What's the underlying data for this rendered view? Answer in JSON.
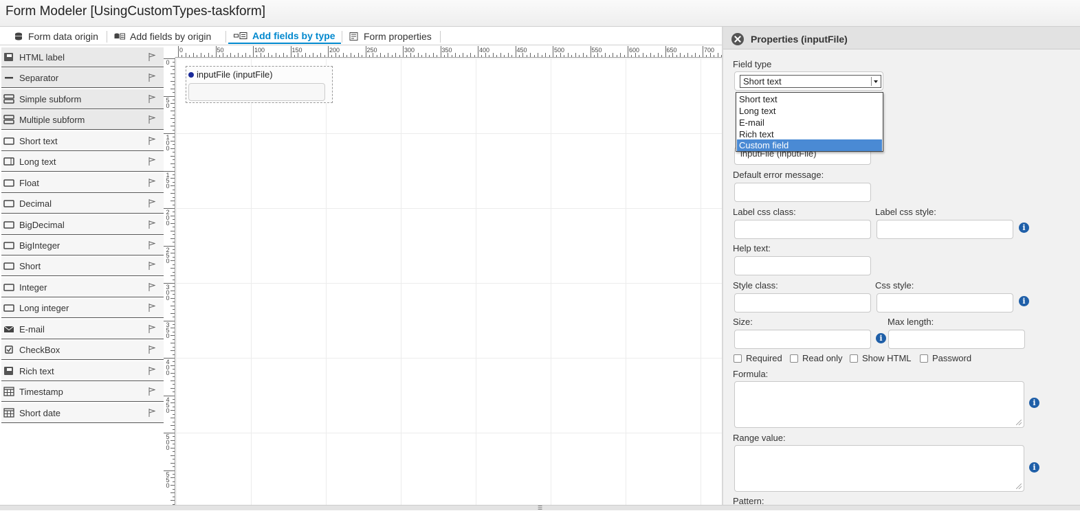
{
  "header": {
    "title": "Form Modeler [UsingCustomTypes-taskform]"
  },
  "tabs": [
    {
      "label": "Form data origin",
      "icon": "database-icon",
      "active": false
    },
    {
      "label": "Add fields by origin",
      "icon": "database-form-icon",
      "active": false
    },
    {
      "label": "Add fields by type",
      "icon": "field-type-icon",
      "active": true
    },
    {
      "label": "Form properties",
      "icon": "form-properties-icon",
      "active": false
    }
  ],
  "palette": {
    "items": [
      {
        "label": "HTML label",
        "icon": "html-label-icon"
      },
      {
        "label": "Separator",
        "icon": "separator-icon"
      },
      {
        "label": "Simple subform",
        "icon": "subform-icon"
      },
      {
        "label": "Multiple subform",
        "icon": "subform-icon"
      },
      {
        "label": "Short text",
        "icon": "textbox-icon"
      },
      {
        "label": "Long text",
        "icon": "textarea-icon"
      },
      {
        "label": "Float",
        "icon": "textbox-icon"
      },
      {
        "label": "Decimal",
        "icon": "textbox-icon"
      },
      {
        "label": "BigDecimal",
        "icon": "textbox-icon"
      },
      {
        "label": "BigInteger",
        "icon": "textbox-icon"
      },
      {
        "label": "Short",
        "icon": "textbox-icon"
      },
      {
        "label": "Integer",
        "icon": "textbox-icon"
      },
      {
        "label": "Long integer",
        "icon": "textbox-icon"
      },
      {
        "label": "E-mail",
        "icon": "email-icon"
      },
      {
        "label": "CheckBox",
        "icon": "checkbox-icon"
      },
      {
        "label": "Rich text",
        "icon": "html-label-icon"
      },
      {
        "label": "Timestamp",
        "icon": "calendar-icon"
      },
      {
        "label": "Short date",
        "icon": "calendar-icon"
      }
    ]
  },
  "ruler": {
    "h_labels": [
      "0",
      "50",
      "100",
      "150",
      "200",
      "250",
      "300",
      "350",
      "400",
      "450",
      "500",
      "550",
      "600",
      "650",
      "700"
    ],
    "v_labels": [
      "0",
      "50",
      "100",
      "150",
      "200",
      "250",
      "300",
      "350",
      "400",
      "450",
      "500",
      "550"
    ]
  },
  "canvas": {
    "field": {
      "label": "inputFile (inputFile)"
    }
  },
  "properties": {
    "title": "Properties (inputFile)",
    "field_type_label": "Field type",
    "field_type_value": "Short text",
    "field_type_options": [
      "Short text",
      "Long text",
      "E-mail",
      "Rich text",
      "Custom field"
    ],
    "field_type_highlighted": "Custom field",
    "label_value": "inputFile (inputFile)",
    "default_error_label": "Default error message:",
    "label_css_class_label": "Label css class:",
    "label_css_style_label": "Label css style:",
    "help_text_label": "Help text:",
    "style_class_label": "Style class:",
    "css_style_label": "Css style:",
    "size_label": "Size:",
    "max_length_label": "Max length:",
    "checkboxes": [
      "Required",
      "Read only",
      "Show HTML",
      "Password"
    ],
    "formula_label": "Formula:",
    "range_value_label": "Range value:",
    "pattern_label": "Pattern:",
    "info_glyph": "i"
  },
  "colors": {
    "accent": "#0088ce",
    "info": "#1f5fa8",
    "selection": "#4a8ad4"
  }
}
